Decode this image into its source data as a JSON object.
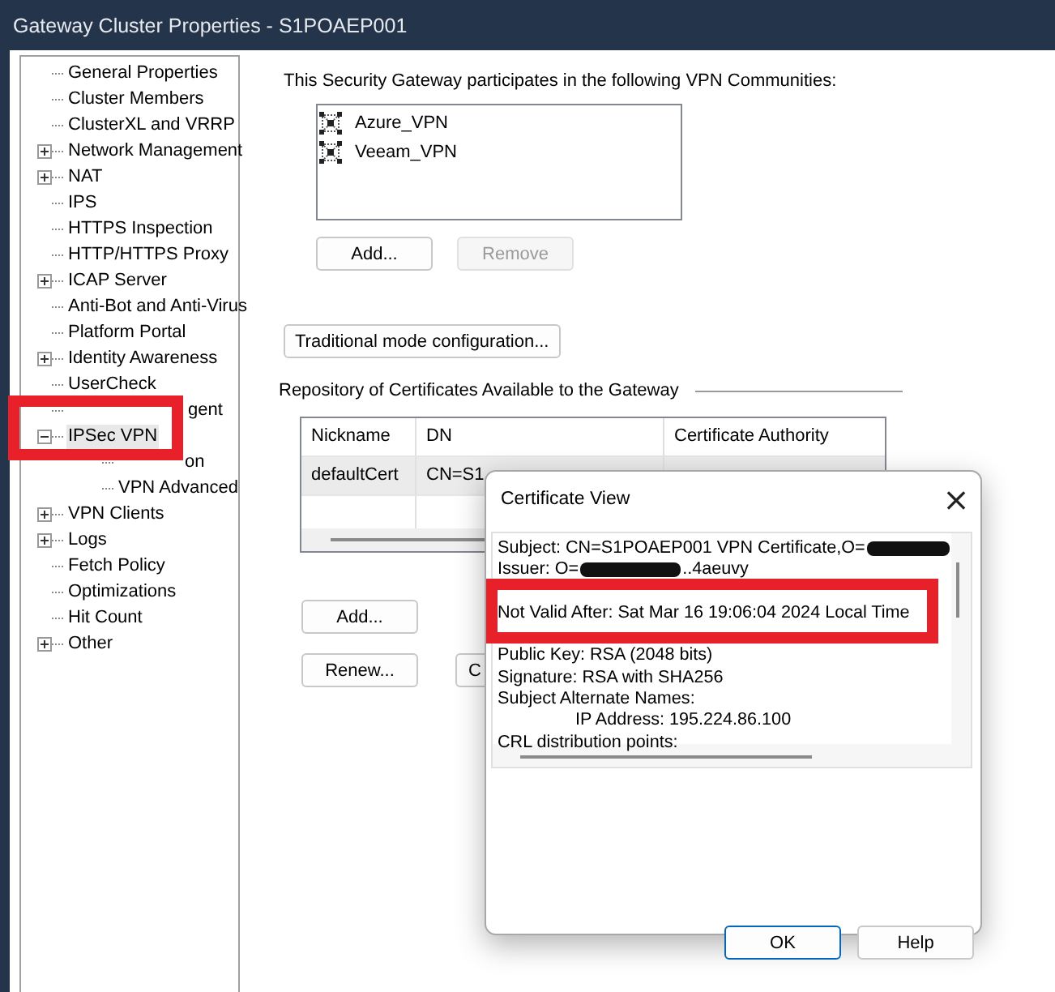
{
  "window": {
    "title": "Gateway Cluster Properties - S1POAEP001"
  },
  "tree": [
    {
      "label": "General Properties"
    },
    {
      "label": "Cluster Members"
    },
    {
      "label": "ClusterXL and VRRP"
    },
    {
      "label": "Network Management",
      "expanded": false
    },
    {
      "label": "NAT",
      "expanded": false
    },
    {
      "label": "IPS"
    },
    {
      "label": "HTTPS Inspection"
    },
    {
      "label": "HTTP/HTTPS Proxy"
    },
    {
      "label": "ICAP Server",
      "expanded": false
    },
    {
      "label": "Anti-Bot and Anti-Virus"
    },
    {
      "label": "Platform Portal"
    },
    {
      "label": "Identity Awareness",
      "expanded": false
    },
    {
      "label": "UserCheck"
    },
    {
      "label": "gent",
      "kind": "obscured"
    },
    {
      "label": "IPSec VPN",
      "expanded": true,
      "selected": true,
      "highlighted": true,
      "children": [
        {
          "label": "on",
          "kind": "obscured"
        },
        {
          "label": "VPN Advanced"
        }
      ]
    },
    {
      "label": "VPN Clients",
      "expanded": false
    },
    {
      "label": "Logs",
      "expanded": false
    },
    {
      "label": "Fetch Policy"
    },
    {
      "label": "Optimizations"
    },
    {
      "label": "Hit Count"
    },
    {
      "label": "Other",
      "expanded": false
    }
  ],
  "communities": {
    "caption": "This Security Gateway participates in the following VPN Communities:",
    "items": [
      "Azure_VPN",
      "Veeam_VPN"
    ],
    "buttons": [
      {
        "label": "Add...",
        "disabled": false
      },
      {
        "label": "Remove",
        "disabled": true
      }
    ]
  },
  "traditional_button": "Traditional mode configuration...",
  "certificates": {
    "caption": "Repository of Certificates Available to the Gateway",
    "columns": [
      "Nickname",
      "DN",
      "Certificate Authority"
    ],
    "rows": [
      [
        "defaultCert",
        "CN=S1",
        ""
      ]
    ],
    "buttons": [
      {
        "label": "Add..."
      },
      {
        "label": "Renew..."
      },
      {
        "label": "C"
      }
    ]
  },
  "dialog": {
    "title": "Certificate View",
    "close": "×",
    "lines": [
      {
        "text": "Subject: CN=S1POAEP001 VPN Certificate,O=",
        "redacted": true
      },
      {
        "text": "Issuer: O=",
        "redacted": true,
        "after": "..4aeuvy"
      },
      {
        "text": "Not Valid After:  Sat Mar 16 19:06:04 2024 Local Time",
        "highlighted": true
      },
      {
        "text": "Public Key: RSA (2048 bits)"
      },
      {
        "text": "Signature: RSA with SHA256"
      },
      {
        "text": "Subject Alternate Names:"
      },
      {
        "text": "IP Address:  195.224.86.100",
        "indent": true
      },
      {
        "text": "CRL distribution points:"
      }
    ],
    "buttons": [
      {
        "label": "OK",
        "default": true
      },
      {
        "label": "Help",
        "default": false
      }
    ]
  }
}
